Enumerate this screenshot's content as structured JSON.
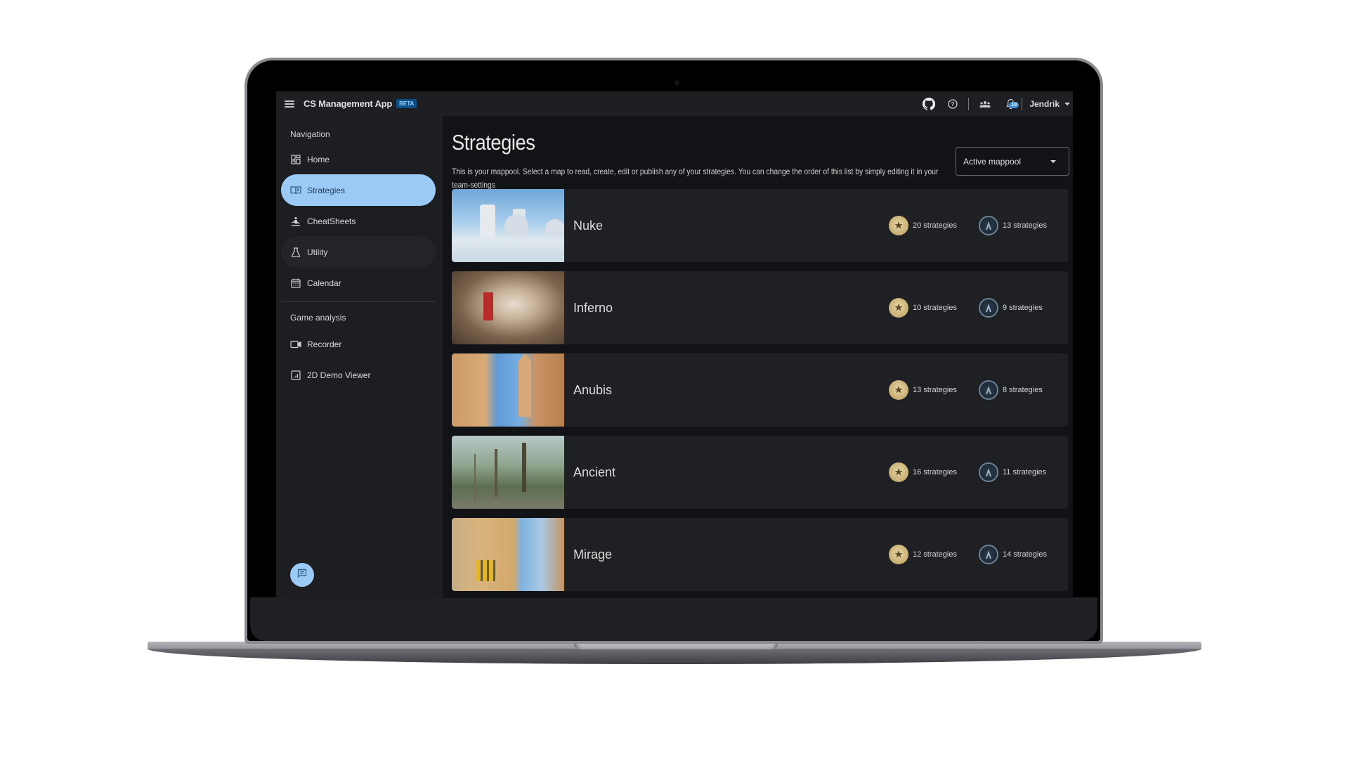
{
  "appbar": {
    "title": "CS Management App",
    "badge": "BETA",
    "icons": [
      "github-icon",
      "help-icon",
      "team-icon",
      "notifications-icon"
    ],
    "notification_count": "10",
    "user_name": "Jendrik"
  },
  "sidebar": {
    "navigation_label": "Navigation",
    "nav_items": [
      {
        "label": "Home",
        "icon": "dashboard-icon"
      },
      {
        "label": "Strategies",
        "icon": "book-icon",
        "active": true
      },
      {
        "label": "CheatSheets",
        "icon": "meditation-icon"
      },
      {
        "label": "Utility",
        "icon": "flask-icon"
      },
      {
        "label": "Calendar",
        "icon": "calendar-icon"
      }
    ],
    "game_analysis_label": "Game analysis",
    "analysis_items": [
      {
        "label": "Recorder",
        "icon": "video-camera-icon"
      },
      {
        "label": "2D Demo Viewer",
        "icon": "chart-box-icon"
      }
    ],
    "fab_icon": "chat-icon"
  },
  "main": {
    "title": "Strategies",
    "description": "This is your mappool. Select a map to read, create, edit or publish any of your strategies. You can change the order of this list by simply editing it in your team-settings",
    "mappool_select": "Active mappool",
    "colors": {
      "accent": "#9ccaf7",
      "beta_badge": "#0b4f86",
      "t_badge": "#d2bd86",
      "ct_badge": "#2b3a4a"
    },
    "maps": [
      {
        "name": "Nuke",
        "t_count": "20 strategies",
        "ct_count": "13 strategies"
      },
      {
        "name": "Inferno",
        "t_count": "10 strategies",
        "ct_count": "9 strategies"
      },
      {
        "name": "Anubis",
        "t_count": "13 strategies",
        "ct_count": "8 strategies"
      },
      {
        "name": "Ancient",
        "t_count": "16 strategies",
        "ct_count": "11 strategies"
      },
      {
        "name": "Mirage",
        "t_count": "12 strategies",
        "ct_count": "14 strategies"
      }
    ]
  }
}
